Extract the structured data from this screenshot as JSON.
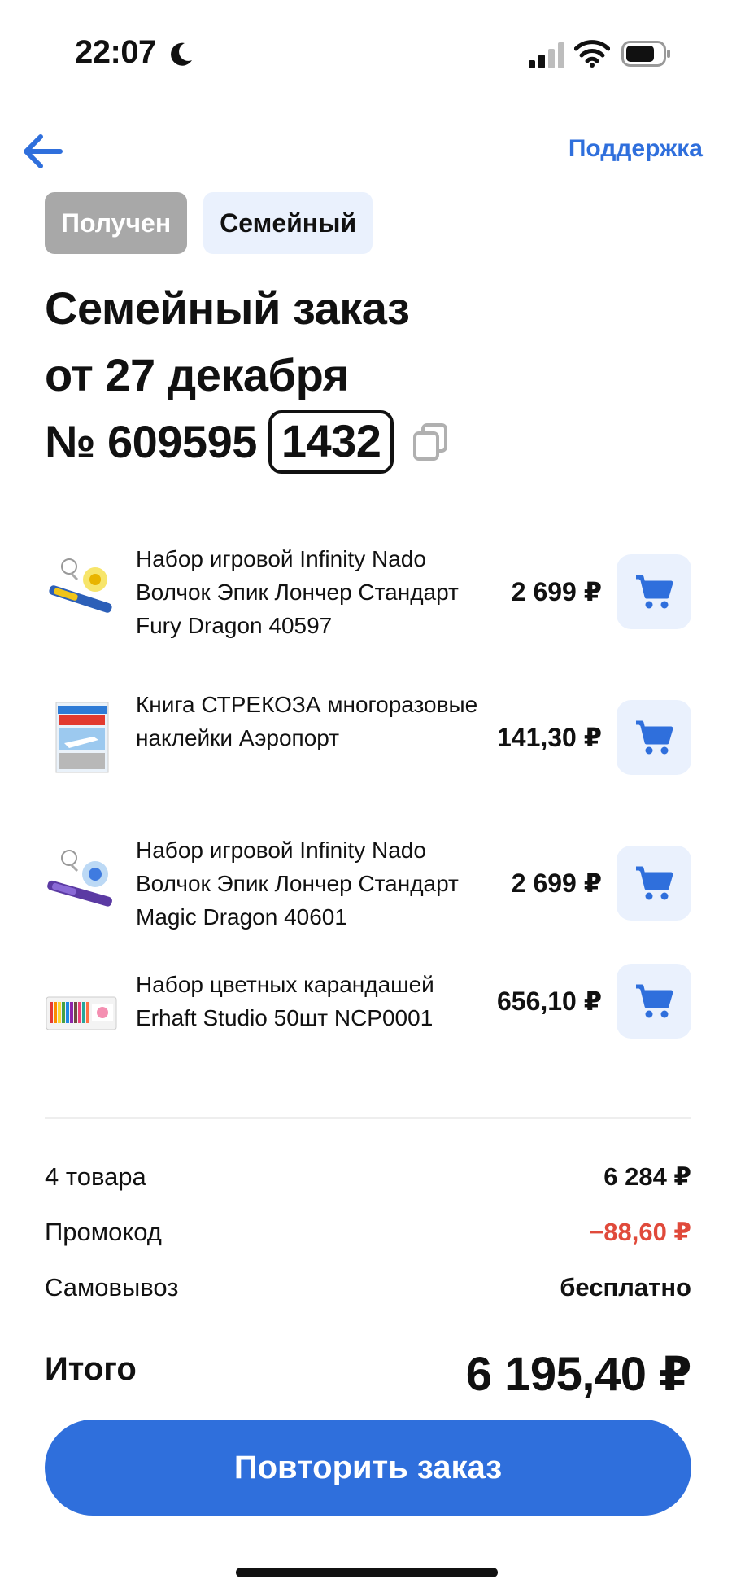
{
  "status_bar": {
    "time": "22:07",
    "icons": [
      "moon-icon",
      "signal-icon",
      "wifi-icon",
      "battery-icon"
    ]
  },
  "header": {
    "back_icon": "arrow-left-icon",
    "support_label": "Поддержка"
  },
  "badges": {
    "status": "Получен",
    "type": "Семейный"
  },
  "order": {
    "title_line1": "Семейный заказ",
    "title_line2": "от 27 декабря",
    "number_prefix": "№ 609595",
    "number_code": "1432",
    "copy_icon": "copy-icon"
  },
  "items": [
    {
      "name": "Набор игровой Infinity Nado Волчок Эпик Лончер Стандарт Fury Dragon 40597",
      "price": "2 699 ₽",
      "thumb": "spinning-top-yellow"
    },
    {
      "name": "Книга СТРЕКОЗА многоразовые наклейки Аэропорт",
      "price": "141,30 ₽",
      "thumb": "sticker-book"
    },
    {
      "name": "Набор игровой Infinity Nado Волчок Эпик Лончер Стандарт Magic Dragon 40601",
      "price": "2 699 ₽",
      "thumb": "spinning-top-purple"
    },
    {
      "name": "Набор цветных карандашей Erhaft Studio 50шт NCP0001",
      "price": "656,10 ₽",
      "thumb": "pencil-set"
    }
  ],
  "summary": {
    "items_label": "4 товара",
    "items_value": "6 284 ₽",
    "promo_label": "Промокод",
    "promo_value": "−88,60 ₽",
    "pickup_label": "Самовывоз",
    "pickup_value": "бесплатно"
  },
  "total": {
    "label": "Итого",
    "value": "6 195,40 ₽"
  },
  "actions": {
    "repeat_label": "Повторить заказ"
  },
  "colors": {
    "accent": "#2f6fdc",
    "accent_light": "#eaf1fd",
    "discount": "#e04a3b",
    "badge_gray": "#a8a8a8"
  }
}
